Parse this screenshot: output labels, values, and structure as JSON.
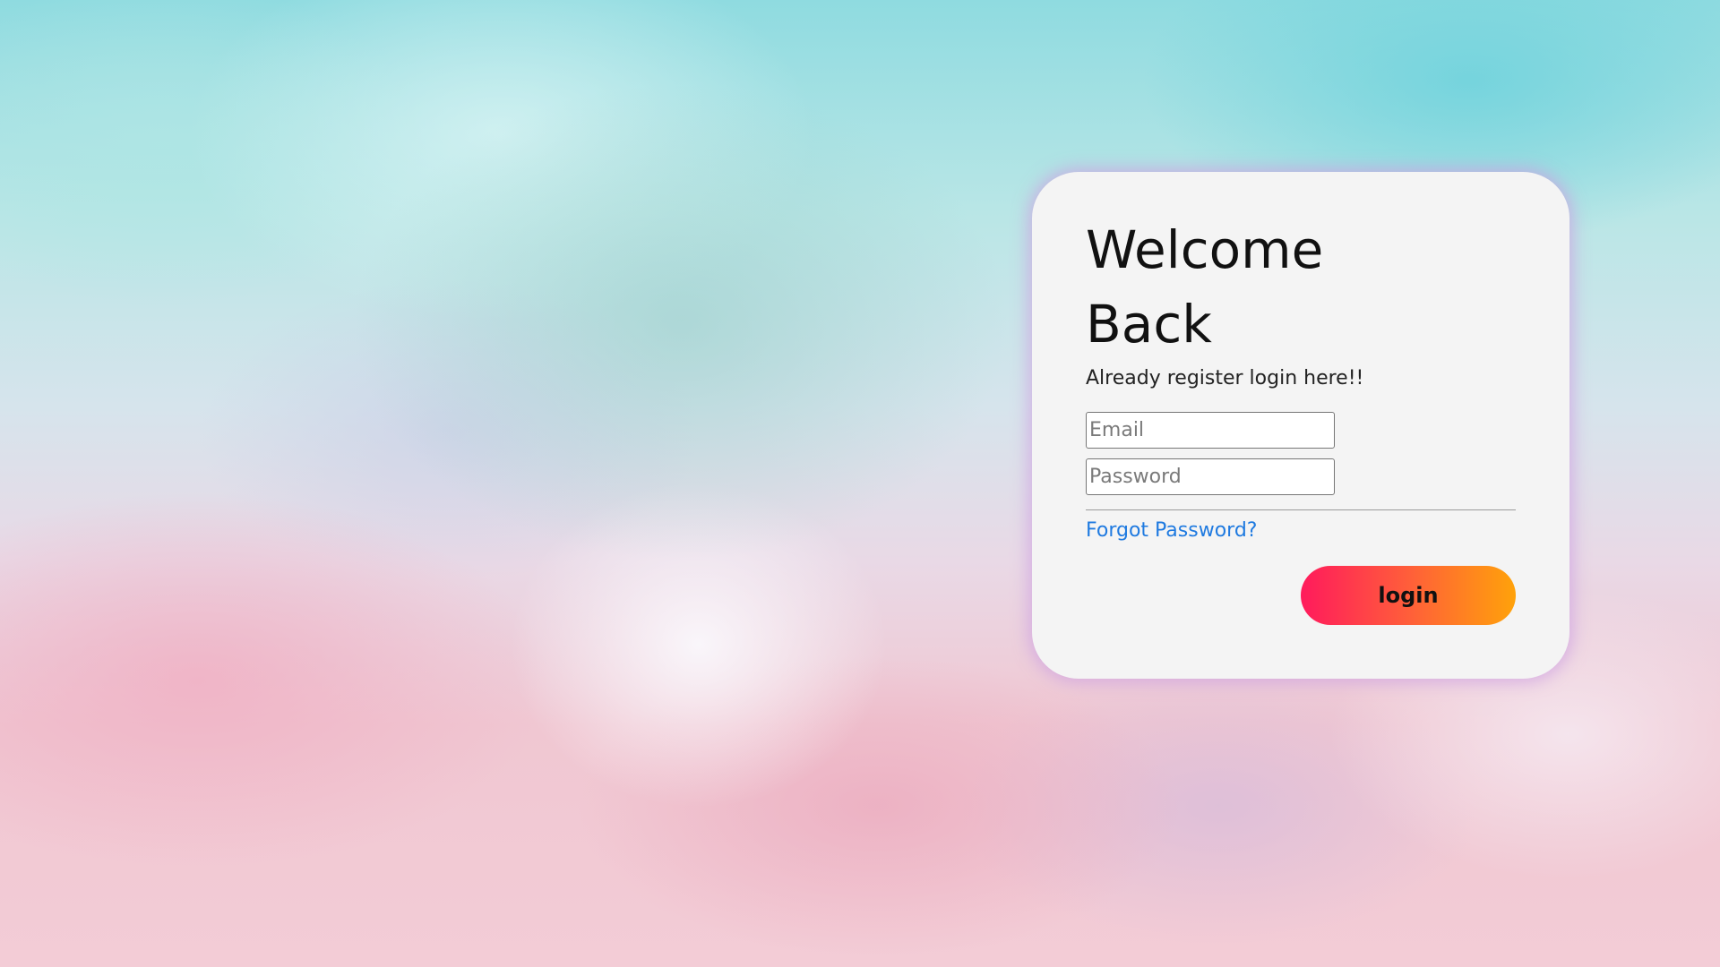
{
  "login_card": {
    "title": "Welcome Back",
    "subtitle": "Already register login here!!",
    "email_placeholder": "Email",
    "password_placeholder": "Password",
    "forgot_password": "Forgot Password?",
    "login_label": "login"
  },
  "colors": {
    "card_background": "#f4f4f4",
    "link": "#1f7ae0",
    "button_gradient_start": "#ff1a5c",
    "button_gradient_end": "#ffa20a",
    "card_glow": "#cda0e1"
  }
}
